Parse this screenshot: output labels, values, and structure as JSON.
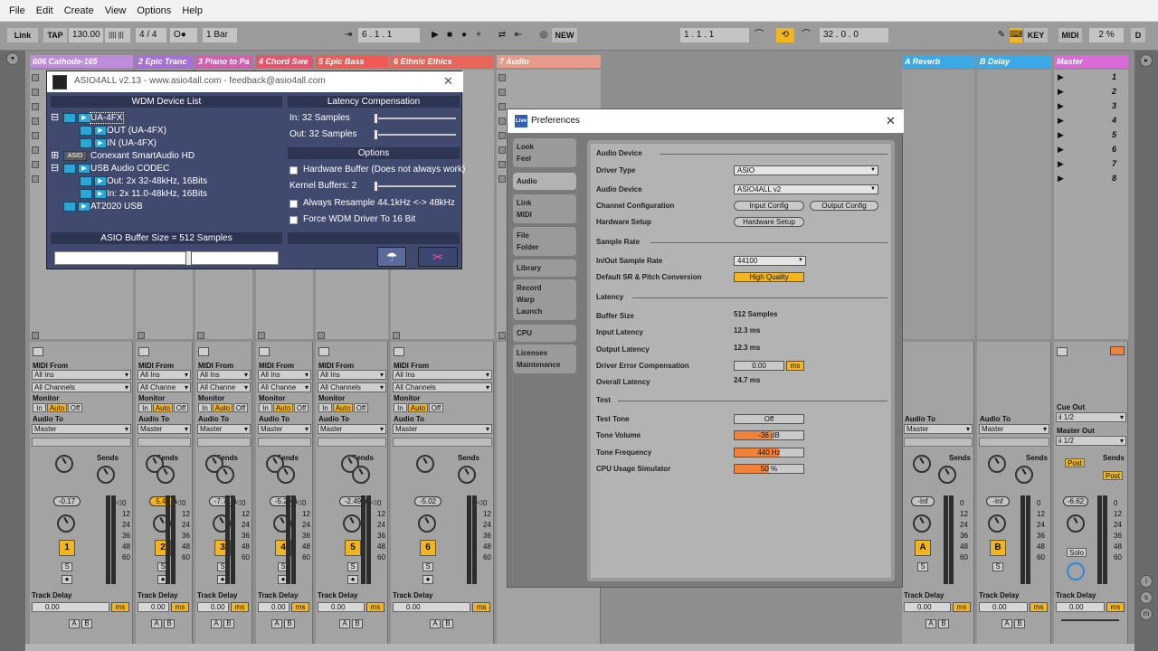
{
  "menubar": [
    "File",
    "Edit",
    "Create",
    "View",
    "Options",
    "Help"
  ],
  "control_bar": {
    "link": "Link",
    "tap": "TAP",
    "tempo": "130.00",
    "meter_icon": "|||| |||",
    "time_sig": "4 / 4",
    "metro": "O●",
    "quantize": "1 Bar",
    "position": "6 .  1 .  1",
    "new": "NEW",
    "loop_start": "1 .  1 .  1",
    "loop_len": "32 .  0 .  0",
    "key": "KEY",
    "midi": "MIDI",
    "cpu": "2 %",
    "d": "D"
  },
  "tracks": [
    {
      "name": "606 Cathode-165",
      "color": "#c08bdb",
      "sel": "MIDI From",
      "in": "All Ins",
      "ch": "All Channels",
      "monitor": "Monitor",
      "audio_to": "Audio To",
      "out": "Master",
      "vol": "-0.17",
      "num": "1",
      "vol_highlight": false
    },
    {
      "name": "2 Epic Tranc",
      "color": "#a770d6",
      "sel": "MIDI From",
      "in": "All Ins",
      "ch": "All Channe",
      "monitor": "Monitor",
      "audio_to": "Audio To",
      "out": "Master",
      "vol": "5.44",
      "num": "2",
      "vol_highlight": true
    },
    {
      "name": "3 Piano to Pa",
      "color": "#d05fb0",
      "sel": "MIDI From",
      "in": "All Ins",
      "ch": "All Channe",
      "monitor": "Monitor",
      "audio_to": "Audio To",
      "out": "Master",
      "vol": "-7.71",
      "num": "3",
      "vol_highlight": false
    },
    {
      "name": "4 Chord Swe",
      "color": "#e8526d",
      "sel": "MIDI From",
      "in": "All Ins",
      "ch": "All Channe",
      "monitor": "Monitor",
      "audio_to": "Audio To",
      "out": "Master",
      "vol": "-5.29",
      "num": "4",
      "vol_highlight": false
    },
    {
      "name": "5 Epic Bass",
      "color": "#ef5a55",
      "sel": "MIDI From",
      "in": "All Ins",
      "ch": "All Channels",
      "monitor": "Monitor",
      "audio_to": "Audio To",
      "out": "Master",
      "vol": "-2.49",
      "num": "5",
      "vol_highlight": false
    },
    {
      "name": "6 Ethnic Ethics",
      "color": "#e8655a",
      "sel": "MIDI From",
      "in": "All Ins",
      "ch": "All Channels",
      "monitor": "Monitor",
      "audio_to": "Audio To",
      "out": "Master",
      "vol": "-5.02",
      "num": "6",
      "vol_highlight": false
    },
    {
      "name": "7 Audio",
      "color": "#e89a88"
    }
  ],
  "returns": [
    {
      "name": "A Reverb",
      "color": "#3aa9e6",
      "audio_to": "Audio To",
      "out": "Master",
      "vol": "-Inf",
      "num": "A"
    },
    {
      "name": "B Delay",
      "color": "#3aa9e6",
      "audio_to": "Audio To",
      "out": "Master",
      "vol": "-Inf",
      "num": "B"
    }
  ],
  "master": {
    "name": "Master",
    "color": "#d96ad8",
    "cue_out": "Cue Out",
    "cue_val": "ii 1/2",
    "master_out": "Master Out",
    "master_val": "ii 1/2",
    "vol": "-6.62",
    "post": "Post",
    "solo": "Solo"
  },
  "scenes": [
    "1",
    "2",
    "3",
    "4",
    "5",
    "6",
    "7",
    "8"
  ],
  "mixer_common": {
    "sends": "Sends",
    "in": "In",
    "auto": "Auto",
    "off": "Off",
    "s": "S",
    "track_delay": "Track Delay",
    "delay_val": "0.00",
    "ms": "ms",
    "a": "A",
    "b": "B",
    "db_ticks": [
      "0",
      "12",
      "24",
      "36",
      "48",
      "60"
    ]
  },
  "asio": {
    "title": "ASIO4ALL v2.13 - www.asio4all.com - feedback@asio4all.com",
    "wdm_header": "WDM Device List",
    "devices": [
      {
        "label": "UA-4FX",
        "indent": 0,
        "expander": "⊟"
      },
      {
        "label": "OUT (UA-4FX)",
        "indent": 1,
        "expander": ""
      },
      {
        "label": "IN (UA-4FX)",
        "indent": 1,
        "expander": ""
      },
      {
        "label": "Conexant SmartAudio HD",
        "indent": 0,
        "expander": "⊞"
      },
      {
        "label": "USB Audio CODEC",
        "indent": 0,
        "expander": "⊟"
      },
      {
        "label": "Out:  2x 32-48kHz, 16Bits",
        "indent": 1,
        "expander": ""
      },
      {
        "label": "In:   2x 11.0-48kHz, 16Bits",
        "indent": 1,
        "expander": ""
      },
      {
        "label": "AT2020 USB",
        "indent": 0,
        "expander": ""
      }
    ],
    "latency_header": "Latency Compensation",
    "latency_in": "In:  32 Samples",
    "latency_out": "Out: 32 Samples",
    "options_header": "Options",
    "options": [
      "Hardware Buffer (Does not always work)",
      "Kernel Buffers: 2",
      "Always Resample 44.1kHz <-> 48kHz",
      "Force WDM Driver To 16 Bit"
    ],
    "buffer_label": "ASIO Buffer Size = 512 Samples",
    "buffer_fraction": 0.6,
    "close": "✕"
  },
  "prefs": {
    "title": "Preferences",
    "logo": "Live",
    "close": "✕",
    "tabs": [
      {
        "lines": [
          "Look",
          "Feel"
        ]
      },
      {
        "lines": [
          "Audio"
        ]
      },
      {
        "lines": [
          "Link",
          "MIDI"
        ]
      },
      {
        "lines": [
          "File",
          "Folder"
        ]
      },
      {
        "lines": [
          "Library"
        ]
      },
      {
        "lines": [
          "Record",
          "Warp",
          "Launch"
        ]
      },
      {
        "lines": [
          "CPU"
        ]
      },
      {
        "lines": [
          "Licenses",
          "Maintenance"
        ]
      }
    ],
    "audio_device": "Audio Device",
    "driver_type_label": "Driver Type",
    "driver_type": "ASIO",
    "audio_device_label": "Audio Device",
    "audio_device_value": "ASIO4ALL v2",
    "channel_config_label": "Channel Configuration",
    "input_config": "Input Config",
    "output_config": "Output Config",
    "hardware_setup_label": "Hardware Setup",
    "hardware_setup": "Hardware Setup",
    "sample_rate": "Sample Rate",
    "sr_label": "In/Out Sample Rate",
    "sr_value": "44100",
    "sr_conv_label": "Default SR & Pitch Conversion",
    "sr_conv_value": "High Quality",
    "latency": "Latency",
    "buffer_size_label": "Buffer Size",
    "buffer_size": "512 Samples",
    "input_latency_label": "Input Latency",
    "input_latency": "12.3 ms",
    "output_latency_label": "Output Latency",
    "output_latency": "12.3 ms",
    "driver_err_label": "Driver Error Compensation",
    "driver_err": "0.00",
    "driver_err_unit": "ms",
    "overall_latency_label": "Overall Latency",
    "overall_latency": "24.7 ms",
    "test": "Test",
    "tone_label": "Test Tone",
    "tone": "Off",
    "tone_vol_label": "Tone Volume",
    "tone_vol": "-36 dB",
    "tone_vol_fraction": 0.55,
    "tone_freq_label": "Tone Frequency",
    "tone_freq": "440 Hz",
    "tone_freq_fraction": 0.65,
    "cpu_sim_label": "CPU Usage Simulator",
    "cpu_sim": "50 %",
    "cpu_sim_fraction": 0.5
  }
}
